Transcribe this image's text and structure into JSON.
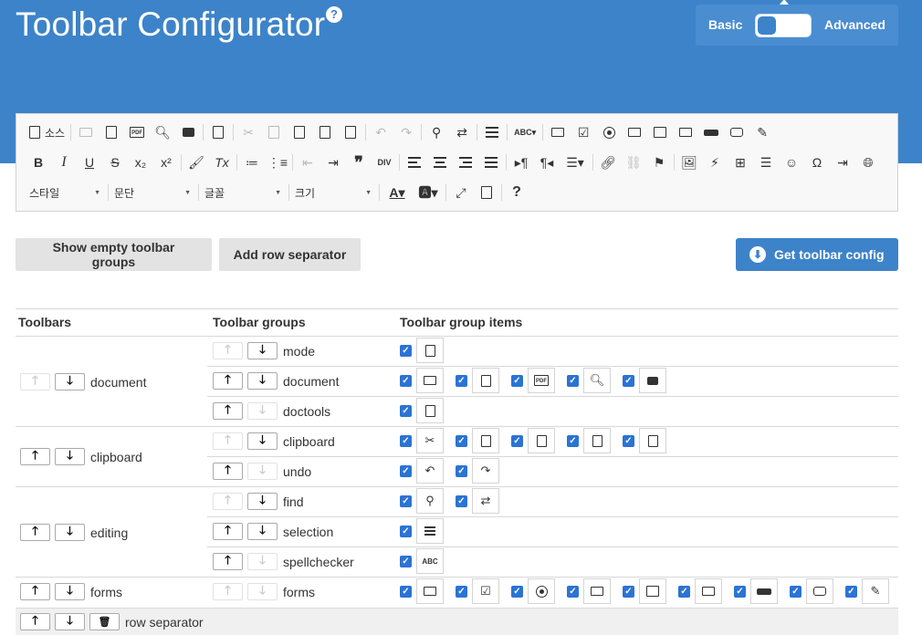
{
  "header": {
    "title": "Toolbar Configurator",
    "help_icon": "question-circle-icon",
    "mode": {
      "basic_label": "Basic",
      "advanced_label": "Advanced",
      "selected": "Basic"
    }
  },
  "editor_toolbar": {
    "row1": {
      "source_label": "소스"
    },
    "combos": [
      {
        "name": "styles",
        "label": "스타일"
      },
      {
        "name": "format",
        "label": "문단"
      },
      {
        "name": "font",
        "label": "글꼴"
      },
      {
        "name": "size",
        "label": "크기"
      }
    ]
  },
  "actions": {
    "show_empty_label": "Show empty toolbar groups",
    "add_separator_label": "Add row separator",
    "get_config_label": "Get toolbar config"
  },
  "table": {
    "headers": {
      "toolbars": "Toolbars",
      "groups": "Toolbar groups",
      "items": "Toolbar group items"
    },
    "toolbars": [
      {
        "name": "document",
        "groups": [
          {
            "name": "mode",
            "items": [
              "source-icon"
            ]
          },
          {
            "name": "document",
            "items": [
              "save-icon",
              "new-page-icon",
              "export-pdf-icon",
              "preview-icon",
              "print-icon"
            ]
          },
          {
            "name": "doctools",
            "items": [
              "templates-icon"
            ]
          }
        ]
      },
      {
        "name": "clipboard",
        "groups": [
          {
            "name": "clipboard",
            "items": [
              "cut-icon",
              "copy-icon",
              "paste-icon",
              "paste-text-icon",
              "paste-word-icon"
            ]
          },
          {
            "name": "undo",
            "items": [
              "undo-icon",
              "redo-icon"
            ]
          }
        ]
      },
      {
        "name": "editing",
        "groups": [
          {
            "name": "find",
            "items": [
              "find-icon",
              "replace-icon"
            ]
          },
          {
            "name": "selection",
            "items": [
              "select-all-icon"
            ]
          },
          {
            "name": "spellchecker",
            "items": [
              "spellcheck-icon"
            ]
          }
        ]
      },
      {
        "name": "forms",
        "groups": [
          {
            "name": "forms",
            "items": [
              "form-icon",
              "checkbox-icon",
              "radio-icon",
              "text-field-icon",
              "textarea-icon",
              "select-icon",
              "button-icon",
              "image-button-icon",
              "hidden-field-icon"
            ]
          }
        ]
      }
    ],
    "row_separator_label": "row separator"
  }
}
